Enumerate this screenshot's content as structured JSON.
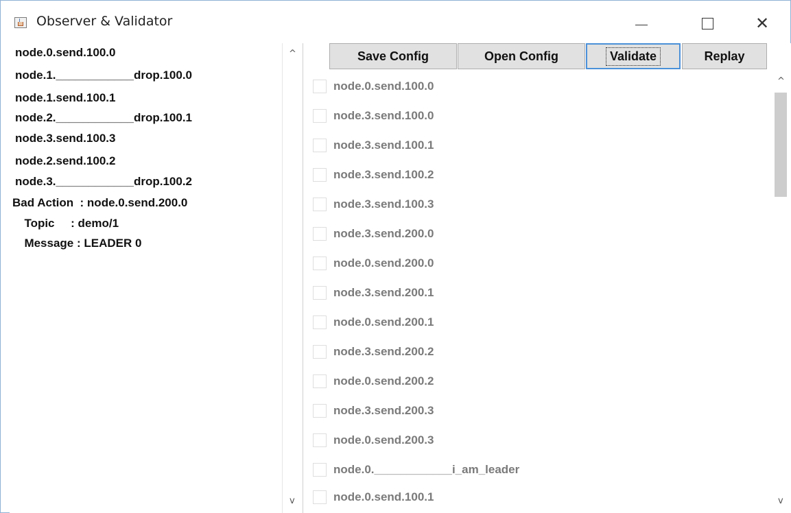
{
  "window": {
    "title": "Observer & Validator",
    "minimize_glyph": "—",
    "close_glyph": "✕"
  },
  "log": {
    "lines": [
      "node.0.send.100.0",
      "node.1.____________drop.100.0",
      "node.1.send.100.1",
      "node.2.____________drop.100.1",
      "node.3.send.100.3",
      "node.2.send.100.2",
      "node.3.____________drop.100.2",
      "Bad Action  : node.0.send.200.0",
      "  Topic     : demo/1",
      "  Message : LEADER 0"
    ],
    "scroll_up": "^",
    "scroll_down": "v"
  },
  "toolbar": {
    "save_label": "Save Config",
    "open_label": "Open Config",
    "validate_label": "Validate",
    "replay_label": "Replay"
  },
  "actions": {
    "items": [
      {
        "label": "node.0.send.100.0",
        "checked": false
      },
      {
        "label": "node.3.send.100.0",
        "checked": false
      },
      {
        "label": "node.3.send.100.1",
        "checked": false
      },
      {
        "label": "node.3.send.100.2",
        "checked": false
      },
      {
        "label": "node.3.send.100.3",
        "checked": false
      },
      {
        "label": "node.3.send.200.0",
        "checked": false
      },
      {
        "label": "node.0.send.200.0",
        "checked": false
      },
      {
        "label": "node.3.send.200.1",
        "checked": false
      },
      {
        "label": "node.0.send.200.1",
        "checked": false
      },
      {
        "label": "node.3.send.200.2",
        "checked": false
      },
      {
        "label": "node.0.send.200.2",
        "checked": false
      },
      {
        "label": "node.3.send.200.3",
        "checked": false
      },
      {
        "label": "node.0.send.200.3",
        "checked": false
      },
      {
        "label": "node.0.____________i_am_leader",
        "checked": false
      },
      {
        "label": "node.0.send.100.1",
        "checked": false
      }
    ],
    "scroll_up": "^",
    "scroll_down": "v"
  },
  "colors": {
    "window_border": "#8fb0d6",
    "button_face": "#e1e1e1",
    "focus_border": "#4a90d9",
    "disabled_text": "#7a7a7a"
  }
}
